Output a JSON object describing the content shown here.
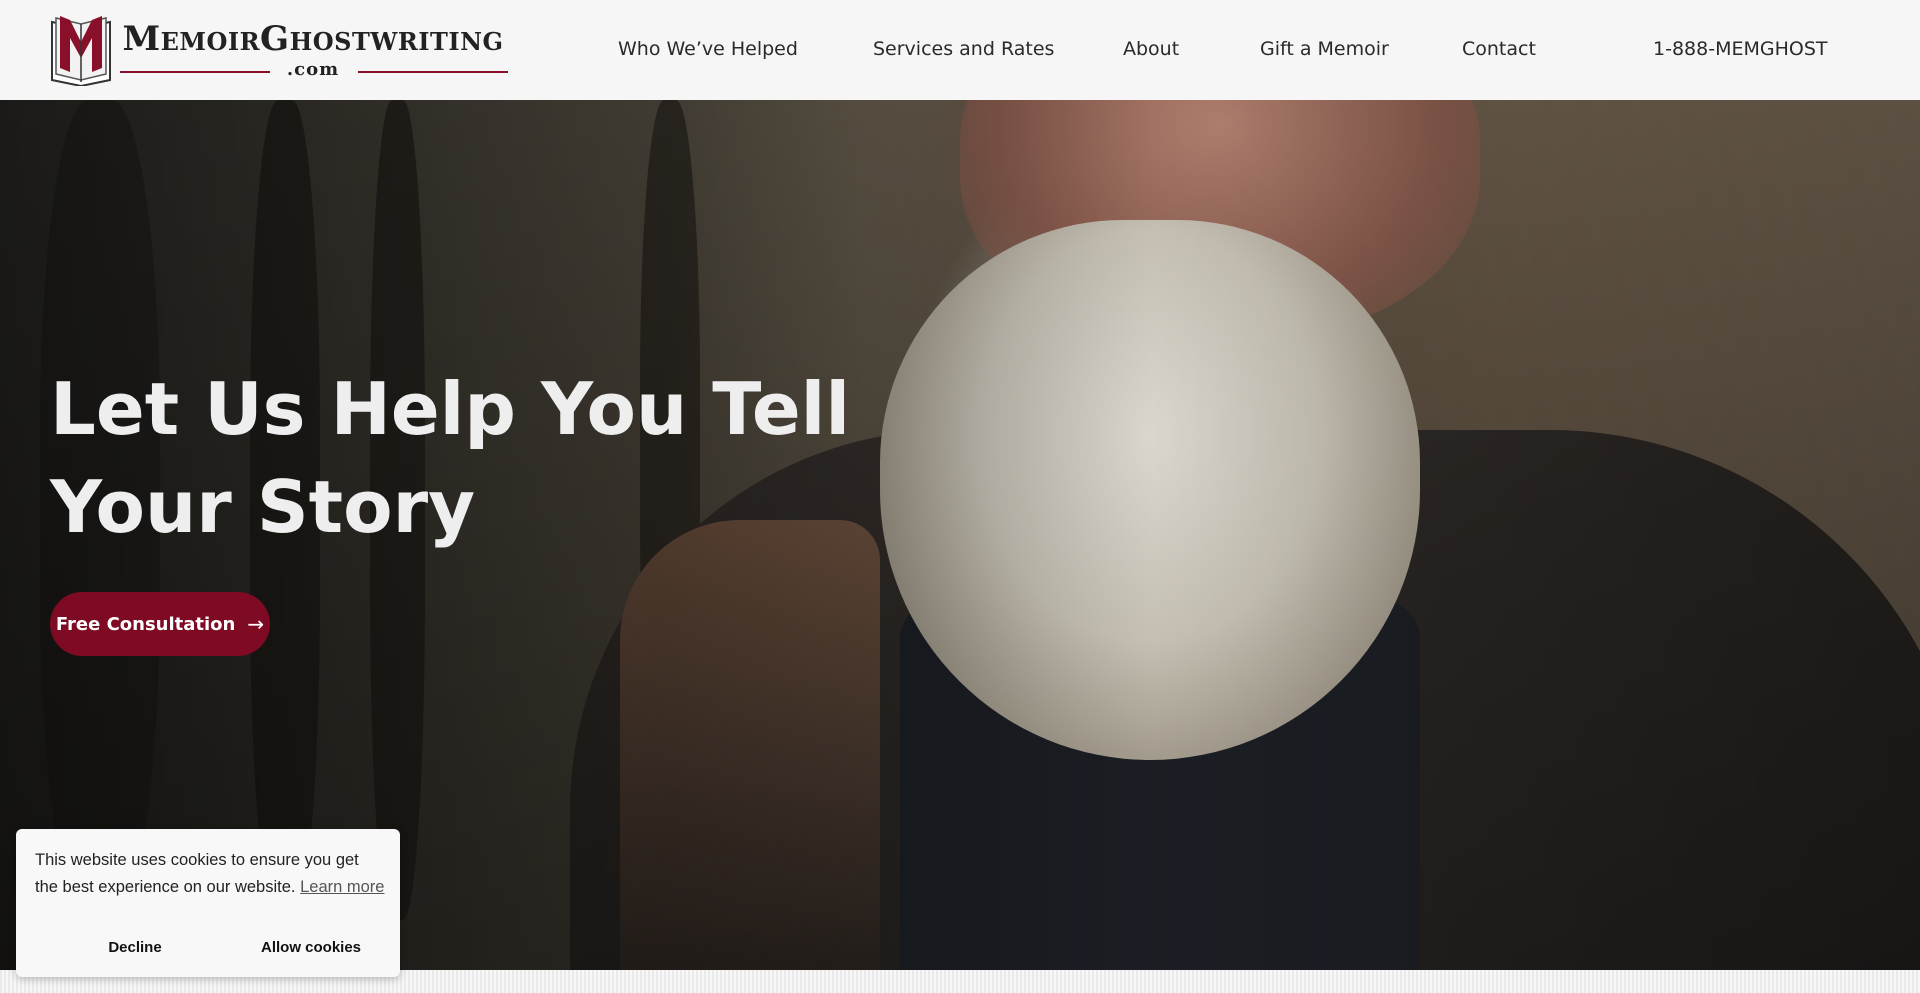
{
  "header": {
    "logo": {
      "name": "MemoirGhostwriting",
      "domain": ".com",
      "brand_color": "#8a0f2a"
    },
    "nav": [
      {
        "label": "Who We’ve Helped"
      },
      {
        "label": "Services and Rates"
      },
      {
        "label": "About"
      },
      {
        "label": "Gift a Memoir"
      },
      {
        "label": "Contact"
      }
    ],
    "phone": "1-888-MEMGHOST"
  },
  "hero": {
    "title": "Let Us Help You Tell Your Story",
    "cta_label": "Free Consultation",
    "cta_icon": "arrow-right-icon",
    "cta_color": "#7e0a23"
  },
  "cookie_banner": {
    "message": "This website uses cookies to ensure you get the best experience on our website.",
    "learn_more": "Learn more",
    "decline": "Decline",
    "allow": "Allow cookies"
  }
}
